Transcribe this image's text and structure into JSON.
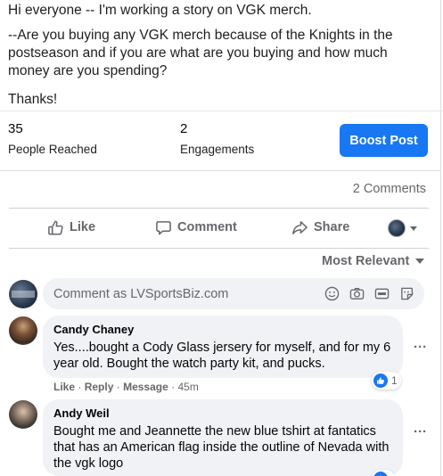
{
  "post": {
    "line1": "Hi everyone -- I'm working a story on VGK merch.",
    "line2": "--Are you buying any VGK merch because of the Knights in the postseason and if you are what are you buying and how much money are you spending?",
    "line3": "Thanks!"
  },
  "stats": {
    "reached_count": "35",
    "reached_label": "People Reached",
    "engagements_count": "2",
    "engagements_label": "Engagements",
    "boost_label": "Boost Post"
  },
  "comments_count": "2 Comments",
  "actions": {
    "like": "Like",
    "comment": "Comment",
    "share": "Share"
  },
  "sort": {
    "label": "Most Relevant"
  },
  "composer": {
    "placeholder": "Comment as LVSportsBiz.com",
    "icons": [
      "emoji-icon",
      "camera-icon",
      "gif-icon",
      "sticker-icon"
    ]
  },
  "comments": [
    {
      "author": "Candy Chaney",
      "text": "Yes....bought a Cody Glass jersery for myself, and for my 6 year old. Bought the watch party kit, and pucks.",
      "like": "Like",
      "reply": "Reply",
      "message": "Message",
      "time": "45m",
      "reactions": "1"
    },
    {
      "author": "Andy Weil",
      "text": "Bought me and Jeannette the new blue tshirt at fantatics that has an American flag inside the outline of Nevada with the vgk logo"
    }
  ],
  "colors": {
    "accent": "#1877f2",
    "secondary_text": "#65676b",
    "bubble": "#f0f2f5"
  }
}
